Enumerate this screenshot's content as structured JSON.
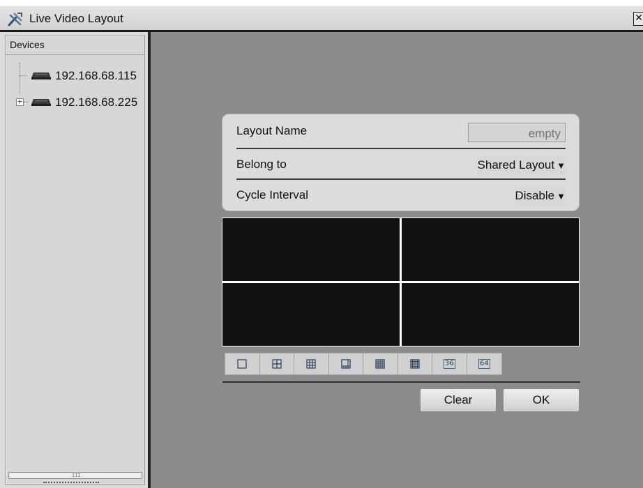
{
  "window": {
    "title": "Live Video Layout",
    "close_glyph": "✕"
  },
  "devices_panel": {
    "header": "Devices",
    "items": [
      {
        "label": "192.168.68.115",
        "icon": "dvr-device-icon",
        "expandable": false
      },
      {
        "label": "192.168.68.225",
        "icon": "dvr-device-icon",
        "expandable": true,
        "expander_glyph": "+"
      }
    ],
    "scroll_grip": "III"
  },
  "layout_form": {
    "layout_name": {
      "label": "Layout Name",
      "placeholder": "empty",
      "value": ""
    },
    "belong_to": {
      "label": "Belong to",
      "value": "Shared Layout"
    },
    "cycle_interval": {
      "label": "Cycle Interval",
      "value": "Disable"
    },
    "caret": "▼"
  },
  "video_grid": {
    "rows": 2,
    "cols": 2,
    "cell_color": "#111111"
  },
  "layout_options": [
    {
      "name": "layout-1-icon",
      "text": ""
    },
    {
      "name": "layout-4-icon",
      "text": ""
    },
    {
      "name": "layout-9-icon",
      "text": ""
    },
    {
      "name": "layout-8-icon",
      "text": ""
    },
    {
      "name": "layout-16-icon",
      "text": ""
    },
    {
      "name": "layout-25-icon",
      "text": ""
    },
    {
      "name": "layout-36-icon",
      "text": "36"
    },
    {
      "name": "layout-64-icon",
      "text": "64"
    }
  ],
  "actions": {
    "clear_label": "Clear",
    "ok_label": "OK"
  },
  "colors": {
    "workspace_bg": "#8c8c8c",
    "panel_bg": "#d7d7d7",
    "icon_blue": "#223a58"
  }
}
